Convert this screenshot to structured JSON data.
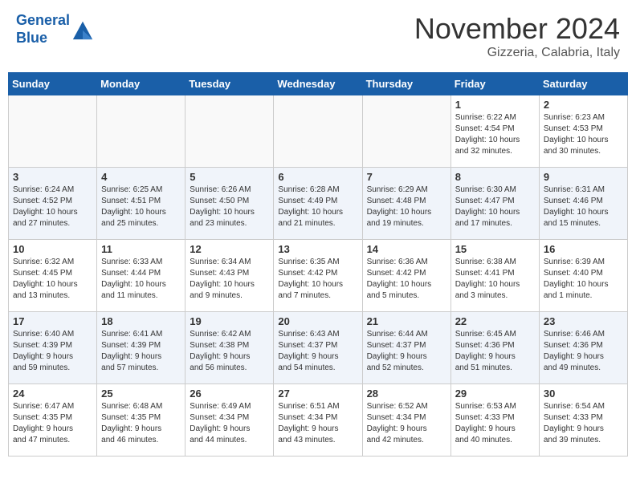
{
  "header": {
    "logo_line1": "General",
    "logo_line2": "Blue",
    "month_title": "November 2024",
    "subtitle": "Gizzeria, Calabria, Italy"
  },
  "weekdays": [
    "Sunday",
    "Monday",
    "Tuesday",
    "Wednesday",
    "Thursday",
    "Friday",
    "Saturday"
  ],
  "weeks": [
    [
      {
        "day": "",
        "info": ""
      },
      {
        "day": "",
        "info": ""
      },
      {
        "day": "",
        "info": ""
      },
      {
        "day": "",
        "info": ""
      },
      {
        "day": "",
        "info": ""
      },
      {
        "day": "1",
        "info": "Sunrise: 6:22 AM\nSunset: 4:54 PM\nDaylight: 10 hours\nand 32 minutes."
      },
      {
        "day": "2",
        "info": "Sunrise: 6:23 AM\nSunset: 4:53 PM\nDaylight: 10 hours\nand 30 minutes."
      }
    ],
    [
      {
        "day": "3",
        "info": "Sunrise: 6:24 AM\nSunset: 4:52 PM\nDaylight: 10 hours\nand 27 minutes."
      },
      {
        "day": "4",
        "info": "Sunrise: 6:25 AM\nSunset: 4:51 PM\nDaylight: 10 hours\nand 25 minutes."
      },
      {
        "day": "5",
        "info": "Sunrise: 6:26 AM\nSunset: 4:50 PM\nDaylight: 10 hours\nand 23 minutes."
      },
      {
        "day": "6",
        "info": "Sunrise: 6:28 AM\nSunset: 4:49 PM\nDaylight: 10 hours\nand 21 minutes."
      },
      {
        "day": "7",
        "info": "Sunrise: 6:29 AM\nSunset: 4:48 PM\nDaylight: 10 hours\nand 19 minutes."
      },
      {
        "day": "8",
        "info": "Sunrise: 6:30 AM\nSunset: 4:47 PM\nDaylight: 10 hours\nand 17 minutes."
      },
      {
        "day": "9",
        "info": "Sunrise: 6:31 AM\nSunset: 4:46 PM\nDaylight: 10 hours\nand 15 minutes."
      }
    ],
    [
      {
        "day": "10",
        "info": "Sunrise: 6:32 AM\nSunset: 4:45 PM\nDaylight: 10 hours\nand 13 minutes."
      },
      {
        "day": "11",
        "info": "Sunrise: 6:33 AM\nSunset: 4:44 PM\nDaylight: 10 hours\nand 11 minutes."
      },
      {
        "day": "12",
        "info": "Sunrise: 6:34 AM\nSunset: 4:43 PM\nDaylight: 10 hours\nand 9 minutes."
      },
      {
        "day": "13",
        "info": "Sunrise: 6:35 AM\nSunset: 4:42 PM\nDaylight: 10 hours\nand 7 minutes."
      },
      {
        "day": "14",
        "info": "Sunrise: 6:36 AM\nSunset: 4:42 PM\nDaylight: 10 hours\nand 5 minutes."
      },
      {
        "day": "15",
        "info": "Sunrise: 6:38 AM\nSunset: 4:41 PM\nDaylight: 10 hours\nand 3 minutes."
      },
      {
        "day": "16",
        "info": "Sunrise: 6:39 AM\nSunset: 4:40 PM\nDaylight: 10 hours\nand 1 minute."
      }
    ],
    [
      {
        "day": "17",
        "info": "Sunrise: 6:40 AM\nSunset: 4:39 PM\nDaylight: 9 hours\nand 59 minutes."
      },
      {
        "day": "18",
        "info": "Sunrise: 6:41 AM\nSunset: 4:39 PM\nDaylight: 9 hours\nand 57 minutes."
      },
      {
        "day": "19",
        "info": "Sunrise: 6:42 AM\nSunset: 4:38 PM\nDaylight: 9 hours\nand 56 minutes."
      },
      {
        "day": "20",
        "info": "Sunrise: 6:43 AM\nSunset: 4:37 PM\nDaylight: 9 hours\nand 54 minutes."
      },
      {
        "day": "21",
        "info": "Sunrise: 6:44 AM\nSunset: 4:37 PM\nDaylight: 9 hours\nand 52 minutes."
      },
      {
        "day": "22",
        "info": "Sunrise: 6:45 AM\nSunset: 4:36 PM\nDaylight: 9 hours\nand 51 minutes."
      },
      {
        "day": "23",
        "info": "Sunrise: 6:46 AM\nSunset: 4:36 PM\nDaylight: 9 hours\nand 49 minutes."
      }
    ],
    [
      {
        "day": "24",
        "info": "Sunrise: 6:47 AM\nSunset: 4:35 PM\nDaylight: 9 hours\nand 47 minutes."
      },
      {
        "day": "25",
        "info": "Sunrise: 6:48 AM\nSunset: 4:35 PM\nDaylight: 9 hours\nand 46 minutes."
      },
      {
        "day": "26",
        "info": "Sunrise: 6:49 AM\nSunset: 4:34 PM\nDaylight: 9 hours\nand 44 minutes."
      },
      {
        "day": "27",
        "info": "Sunrise: 6:51 AM\nSunset: 4:34 PM\nDaylight: 9 hours\nand 43 minutes."
      },
      {
        "day": "28",
        "info": "Sunrise: 6:52 AM\nSunset: 4:34 PM\nDaylight: 9 hours\nand 42 minutes."
      },
      {
        "day": "29",
        "info": "Sunrise: 6:53 AM\nSunset: 4:33 PM\nDaylight: 9 hours\nand 40 minutes."
      },
      {
        "day": "30",
        "info": "Sunrise: 6:54 AM\nSunset: 4:33 PM\nDaylight: 9 hours\nand 39 minutes."
      }
    ]
  ]
}
